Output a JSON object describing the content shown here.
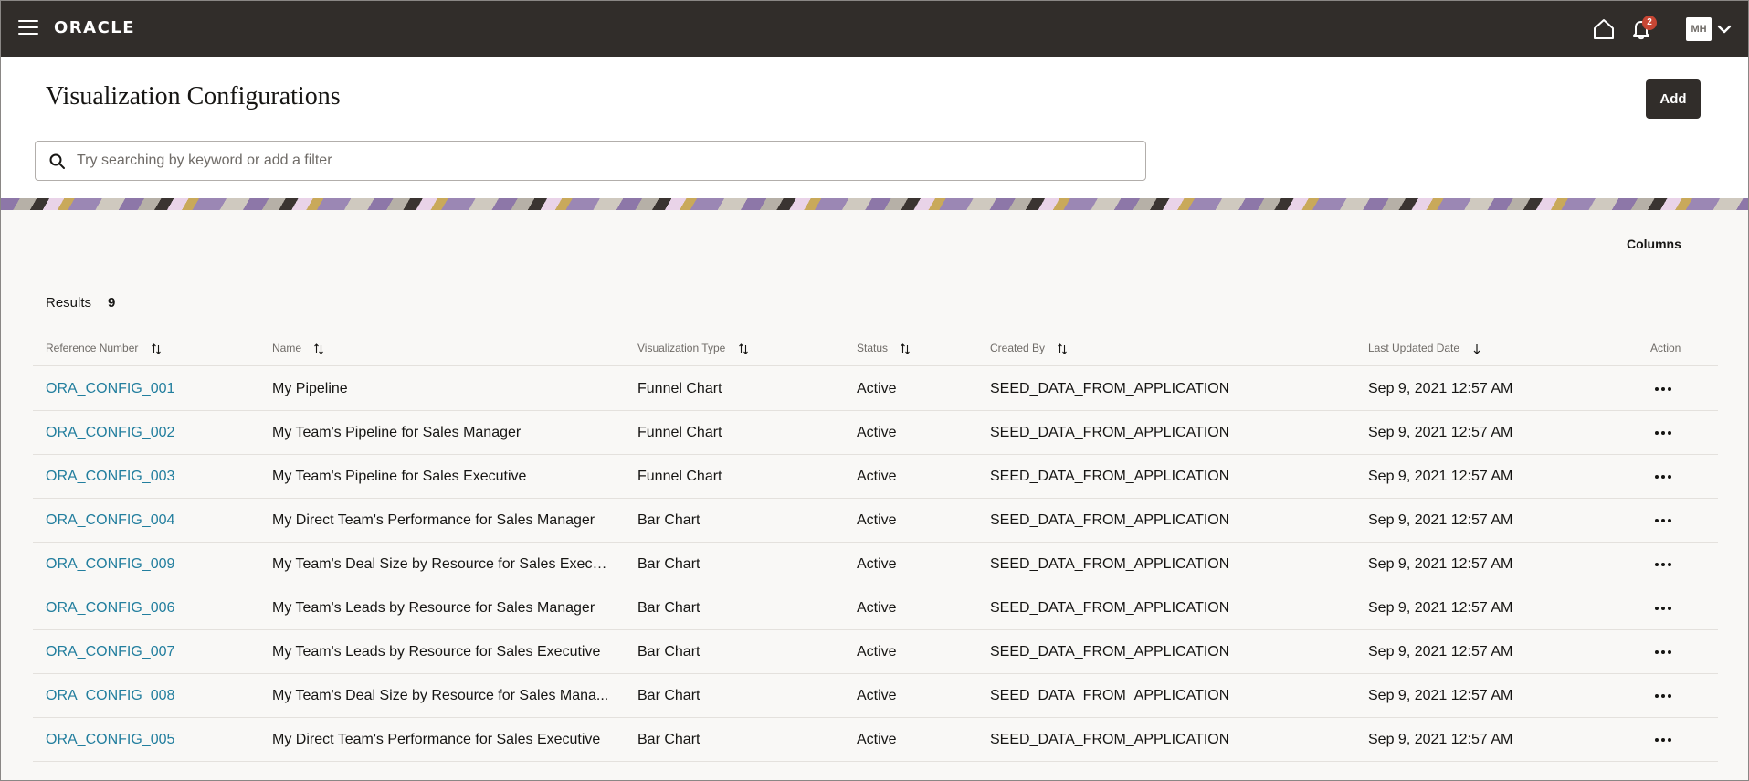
{
  "header": {
    "logo": "ORACLE",
    "notifications_count": "2",
    "user_initials": "MH"
  },
  "page": {
    "title": "Visualization Configurations",
    "add_label": "Add",
    "search_placeholder": "Try searching by keyword or add a filter"
  },
  "results": {
    "columns_label": "Columns",
    "label": "Results",
    "count": "9"
  },
  "table": {
    "headers": {
      "ref": "Reference Number",
      "name": "Name",
      "type": "Visualization Type",
      "status": "Status",
      "created_by": "Created By",
      "updated": "Last Updated Date",
      "action": "Action"
    },
    "rows": [
      {
        "ref": "ORA_CONFIG_001",
        "name": "My Pipeline",
        "type": "Funnel Chart",
        "status": "Active",
        "created_by": "SEED_DATA_FROM_APPLICATION",
        "updated": "Sep 9, 2021 12:57 AM"
      },
      {
        "ref": "ORA_CONFIG_002",
        "name": "My Team's Pipeline for Sales Manager",
        "type": "Funnel Chart",
        "status": "Active",
        "created_by": "SEED_DATA_FROM_APPLICATION",
        "updated": "Sep 9, 2021 12:57 AM"
      },
      {
        "ref": "ORA_CONFIG_003",
        "name": "My Team's Pipeline for Sales Executive",
        "type": "Funnel Chart",
        "status": "Active",
        "created_by": "SEED_DATA_FROM_APPLICATION",
        "updated": "Sep 9, 2021 12:57 AM"
      },
      {
        "ref": "ORA_CONFIG_004",
        "name": "My Direct Team's Performance for Sales Manager",
        "type": "Bar Chart",
        "status": "Active",
        "created_by": "SEED_DATA_FROM_APPLICATION",
        "updated": "Sep 9, 2021 12:57 AM"
      },
      {
        "ref": "ORA_CONFIG_009",
        "name": "My Team's Deal Size by Resource for Sales Execu...",
        "type": "Bar Chart",
        "status": "Active",
        "created_by": "SEED_DATA_FROM_APPLICATION",
        "updated": "Sep 9, 2021 12:57 AM"
      },
      {
        "ref": "ORA_CONFIG_006",
        "name": "My Team's Leads by Resource for Sales Manager",
        "type": "Bar Chart",
        "status": "Active",
        "created_by": "SEED_DATA_FROM_APPLICATION",
        "updated": "Sep 9, 2021 12:57 AM"
      },
      {
        "ref": "ORA_CONFIG_007",
        "name": "My Team's Leads by Resource for Sales Executive",
        "type": "Bar Chart",
        "status": "Active",
        "created_by": "SEED_DATA_FROM_APPLICATION",
        "updated": "Sep 9, 2021 12:57 AM"
      },
      {
        "ref": "ORA_CONFIG_008",
        "name": "My Team's Deal Size by Resource for Sales Mana...",
        "type": "Bar Chart",
        "status": "Active",
        "created_by": "SEED_DATA_FROM_APPLICATION",
        "updated": "Sep 9, 2021 12:57 AM"
      },
      {
        "ref": "ORA_CONFIG_005",
        "name": "My Direct Team's Performance for Sales Executive",
        "type": "Bar Chart",
        "status": "Active",
        "created_by": "SEED_DATA_FROM_APPLICATION",
        "updated": "Sep 9, 2021 12:57 AM"
      }
    ]
  },
  "icons": {
    "menu": "hamburger-icon",
    "home": "home-icon",
    "notifications": "bell-icon",
    "user_menu": "chevron-down-icon",
    "search": "search-icon",
    "sort": "sort-icon",
    "sort_desc": "arrow-down-icon",
    "row_action": "more-icon"
  },
  "colors": {
    "topbar": "#312d2a",
    "link": "#227e9e",
    "badge": "#c74634"
  }
}
